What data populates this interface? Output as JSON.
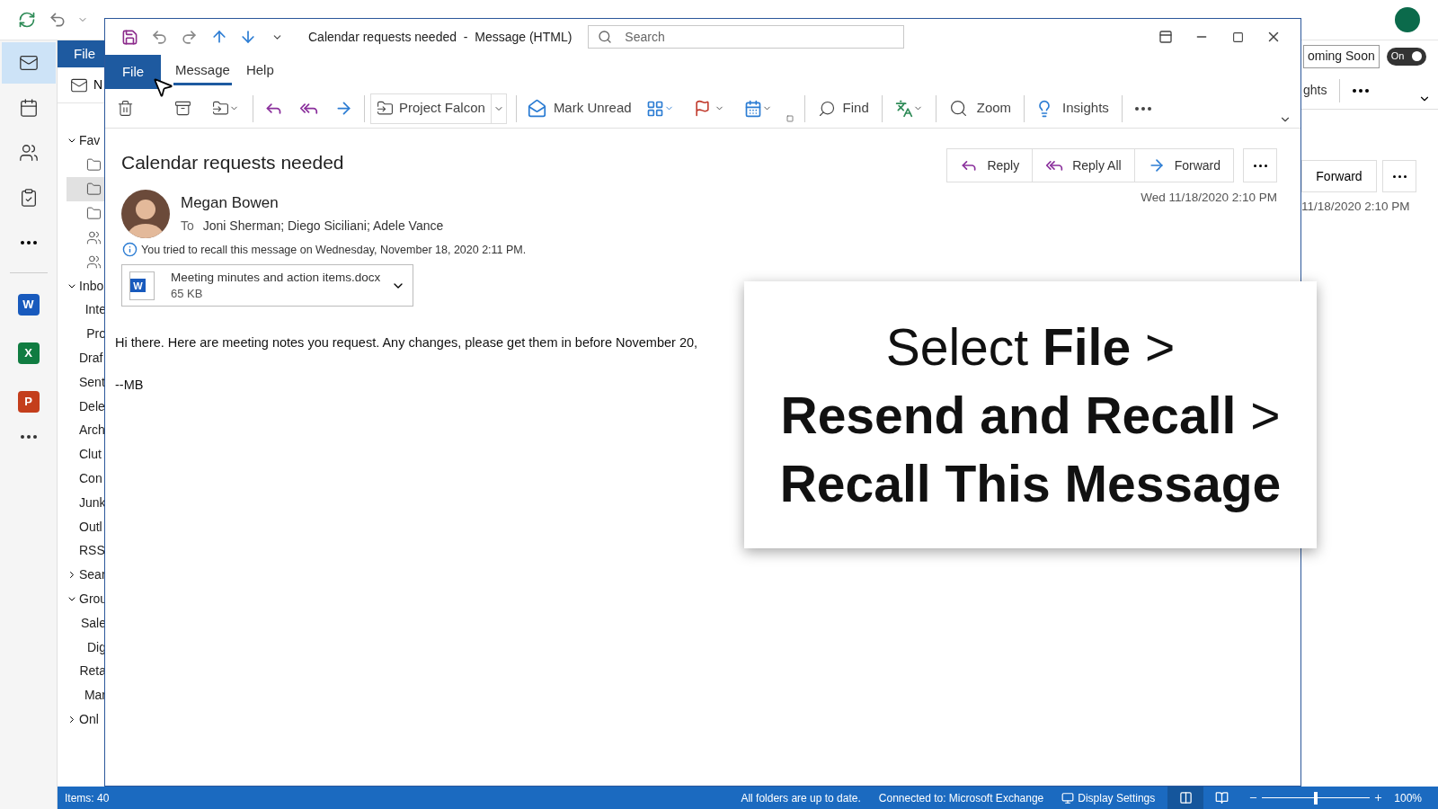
{
  "main_window": {
    "file_tab": "File",
    "new_item_partial": "N",
    "rail": {
      "items": [
        {
          "kind": "mail",
          "selected": true
        },
        {
          "kind": "calendar",
          "selected": false
        },
        {
          "kind": "people",
          "selected": false
        },
        {
          "kind": "tasks",
          "selected": false
        },
        {
          "kind": "more",
          "selected": false
        }
      ],
      "apps": [
        {
          "letter": "W",
          "color": "#185abd"
        },
        {
          "letter": "X",
          "color": "#107c41"
        },
        {
          "letter": "P",
          "color": "#c43e1c"
        }
      ]
    },
    "folders": [
      {
        "label": "Fav",
        "expanded": true,
        "children": [
          {
            "kind": "folder",
            "selected": false
          },
          {
            "kind": "folder",
            "selected": true
          },
          {
            "kind": "folder",
            "selected": false
          },
          {
            "kind": "group",
            "selected": false
          },
          {
            "kind": "group",
            "selected": false
          }
        ]
      },
      {
        "label": "Inbo",
        "expanded": true,
        "children": [
          {
            "label": "Inte"
          },
          {
            "label": "Pro"
          }
        ]
      },
      {
        "label": "Draf"
      },
      {
        "label": "Sent"
      },
      {
        "label": "Dele"
      },
      {
        "label": "Arch"
      },
      {
        "label": "Clut"
      },
      {
        "label": "Con"
      },
      {
        "label": "Junk"
      },
      {
        "label": "Outl"
      },
      {
        "label": "RSS"
      },
      {
        "label": "Sear",
        "expanded": false
      },
      {
        "label": "Grou",
        "expanded": true,
        "children": [
          {
            "label": "Sale"
          },
          {
            "label": "Dig"
          },
          {
            "label": "Reta"
          },
          {
            "label": "Mar"
          }
        ]
      },
      {
        "label": "Onl",
        "expanded": false
      }
    ],
    "right_pane": {
      "coming_soon": "oming Soon",
      "toggle": {
        "label": "On",
        "on": true
      },
      "insights_partial": "ghts",
      "forward": "Forward",
      "date": "11/18/2020 2:10 PM"
    }
  },
  "message_window": {
    "title": "Calendar requests needed  -  Message (HTML)",
    "search": {
      "placeholder": "Search"
    },
    "tabs": [
      {
        "label": "File",
        "kind": "backstage",
        "selected": false
      },
      {
        "label": "Message",
        "kind": "tab",
        "selected": true
      },
      {
        "label": "Help",
        "kind": "tab",
        "selected": false
      }
    ],
    "toolbar": {
      "quick_step": "Project Falcon",
      "mark_unread": "Mark Unread",
      "find": "Find",
      "zoom": "Zoom",
      "insights": "Insights"
    },
    "subject": "Calendar requests needed",
    "sender": "Megan Bowen",
    "to_label": "To",
    "recipients": "Joni Sherman; Diego Siciliani; Adele Vance",
    "actions": [
      "Reply",
      "Reply All",
      "Forward"
    ],
    "date": "Wed 11/18/2020 2:10 PM",
    "info": "You tried to recall this message on Wednesday, November 18, 2020 2:11 PM.",
    "attachment": {
      "type_letter": "W",
      "name": "Meeting minutes and action items.docx",
      "size": "65 KB"
    },
    "body": [
      "Hi there. Here are meeting notes you request. Any changes, please get them in before November 20,",
      "--MB"
    ]
  },
  "caption": "Select **File** >\n**Resend and Recall** >\n**Recall This Message**",
  "status_bar": {
    "items": "Items: 40",
    "sync": "All folders are up to date.",
    "connection": "Connected to: Microsoft Exchange",
    "display_settings": "Display Settings",
    "views": [
      {
        "selected": true
      },
      {
        "selected": false
      }
    ],
    "zoom": {
      "level": 0.5
    },
    "zoom_label": "100%"
  }
}
